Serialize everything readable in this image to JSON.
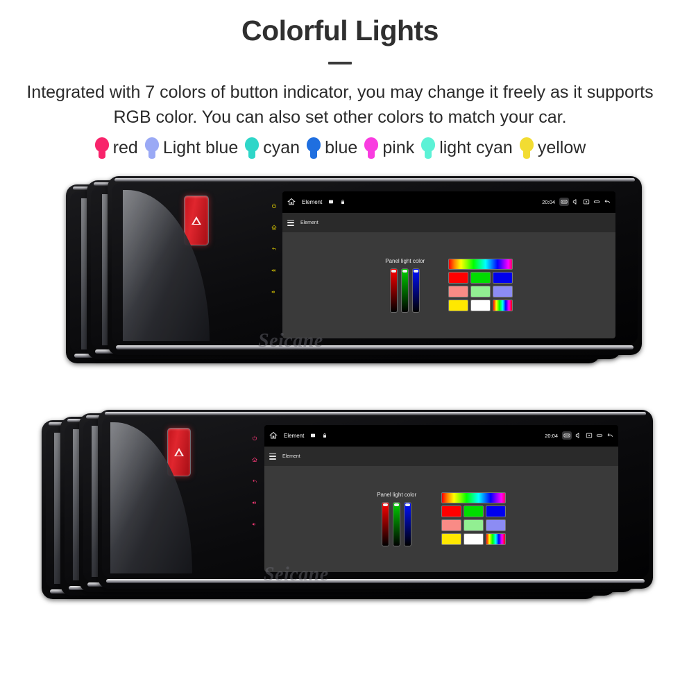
{
  "header": {
    "title": "Colorful Lights",
    "subtitle": "Integrated with 7 colors of button indicator, you may change it freely as it supports RGB color. You can also set other colors to match your car."
  },
  "legend": {
    "items": [
      {
        "label": "red",
        "color": "#f8246b",
        "icon": "bulb-icon"
      },
      {
        "label": "Light blue",
        "color": "#9aa9f5",
        "icon": "bulb-icon"
      },
      {
        "label": "cyan",
        "color": "#2fd6c8",
        "icon": "bulb-icon"
      },
      {
        "label": "blue",
        "color": "#1f6fe0",
        "icon": "bulb-icon"
      },
      {
        "label": "pink",
        "color": "#f93ce0",
        "icon": "bulb-icon"
      },
      {
        "label": "light cyan",
        "color": "#5cf2d6",
        "icon": "bulb-icon"
      },
      {
        "label": "yellow",
        "color": "#f2dc32",
        "icon": "bulb-icon"
      }
    ]
  },
  "device_screen": {
    "statusbar": {
      "home_icon": "home-icon",
      "title": "Element",
      "image_icon": "image-icon",
      "lock_icon": "lock-icon",
      "time": "20:04",
      "right_icons": [
        "keyboard-icon",
        "volume-icon",
        "screenshot-icon",
        "recents-icon",
        "back-icon"
      ]
    },
    "appbar": {
      "menu_icon": "hamburger-icon",
      "title": "Element"
    },
    "panel": {
      "title": "Panel light color",
      "sliders": [
        {
          "name": "red-slider",
          "color": "#ff0000",
          "value": 100
        },
        {
          "name": "green-slider",
          "color": "#00d000",
          "value": 100
        },
        {
          "name": "blue-slider",
          "color": "#0010ff",
          "value": 100
        }
      ],
      "gradient_bar": "rainbow-spectrum",
      "swatch_rows": [
        [
          {
            "name": "swatch-red",
            "color": "#ff0000"
          },
          {
            "name": "swatch-green",
            "color": "#00dd00"
          },
          {
            "name": "swatch-blue",
            "color": "#0000ee"
          }
        ],
        [
          {
            "name": "swatch-salmon",
            "color": "#f98b86"
          },
          {
            "name": "swatch-lightgreen",
            "color": "#92ef92"
          },
          {
            "name": "swatch-periwinkle",
            "color": "#8c8cf4"
          }
        ],
        [
          {
            "name": "swatch-yellow",
            "color": "#ffe800"
          },
          {
            "name": "swatch-white",
            "color": "#ffffff"
          },
          {
            "name": "swatch-rainbow",
            "color": "rainbow"
          }
        ]
      ]
    }
  },
  "units": {
    "group_top": {
      "count": 3,
      "hazard_icon": "hazard-triangle-icon",
      "key_color": "#e8d400",
      "keys": [
        "power-icon",
        "home-icon",
        "back-icon",
        "volume-up-icon",
        "volume-down-icon"
      ]
    },
    "group_bottom": {
      "count": 4,
      "hazard_icon": "hazard-triangle-icon",
      "key_colors": [
        "#ff2b2b",
        "#2bff4d",
        "#2b4dff",
        "#ff3b7a"
      ],
      "keys": [
        "power-icon",
        "home-icon",
        "back-icon",
        "volume-up-icon",
        "volume-down-icon"
      ]
    }
  },
  "watermark": {
    "text": "Seicane"
  }
}
